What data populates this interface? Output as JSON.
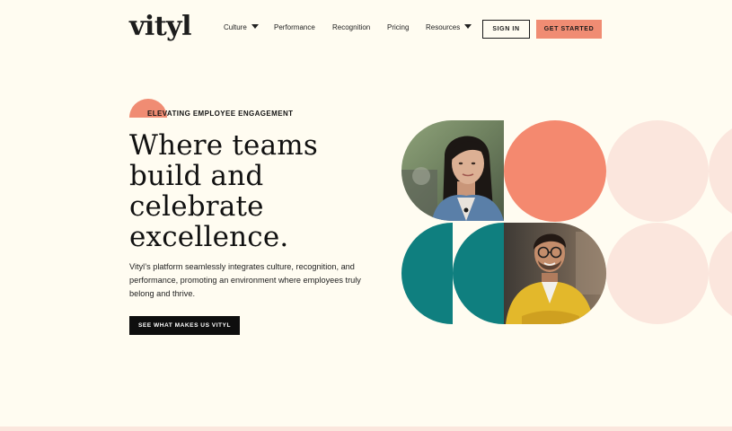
{
  "header": {
    "logo_text": "vityl",
    "nav": [
      {
        "label": "Culture",
        "has_caret": true
      },
      {
        "label": "Performance",
        "has_caret": false
      },
      {
        "label": "Recognition",
        "has_caret": false
      },
      {
        "label": "Pricing",
        "has_caret": false
      },
      {
        "label": "Resources",
        "has_caret": true
      }
    ],
    "sign_in_label": "SIGN IN",
    "get_started_label": "GET STARTED"
  },
  "hero": {
    "eyebrow": "ELEVATING EMPLOYEE ENGAGEMENT",
    "headline": [
      "Where teams",
      "build and",
      "celebrate",
      "excellence."
    ],
    "body": "Vityl’s platform seamlessly integrates culture, recognition, and performance, promoting an environment where employees truly belong and thrive.",
    "cta_label": "SEE WHAT MAKES US VITYL"
  },
  "colors": {
    "background": "#fffcf1",
    "coral": "#f08c73",
    "teal": "#0f7f7f",
    "blush": "#fbe6dd",
    "logo_dot": "#3ca989",
    "ink": "#141414"
  }
}
